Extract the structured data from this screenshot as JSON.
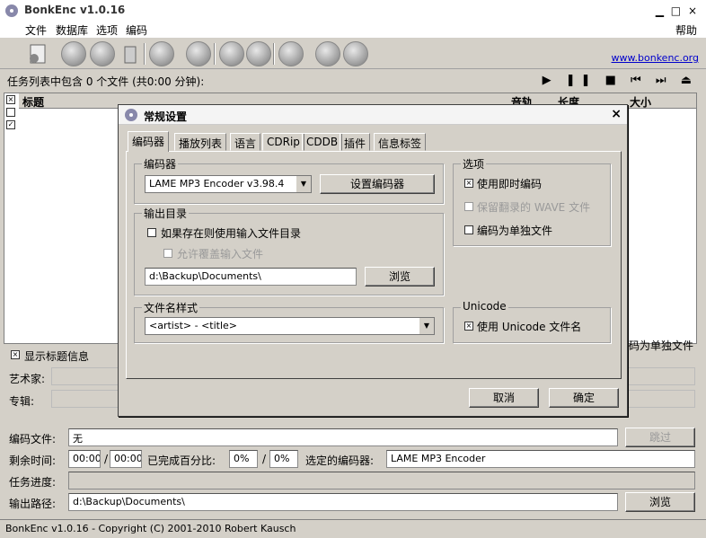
{
  "app": {
    "title": "BonkEnc v1.0.16",
    "controls": "▁ □ ×",
    "website": "www.bonkenc.org"
  },
  "menu": {
    "file": "文件",
    "database": "数据库",
    "options": "选项",
    "encode": "编码",
    "help": "帮助"
  },
  "status": {
    "summary": "任务列表中包含 0 个文件 (共0:00 分钟):"
  },
  "list": {
    "columns": [
      "标题",
      "音轨",
      "长度",
      "大小"
    ]
  },
  "info": {
    "show_title_info": "显示标题信息",
    "artist_label": "艺术家:",
    "album_label": "专辑:",
    "encode_single": "码为单独文件"
  },
  "progress": {
    "encoding_file_label": "编码文件:",
    "encoding_file_value": "无",
    "skip_button": "跳过",
    "remaining_label": "剩余时间:",
    "remaining_value": "00:00",
    "slash": "/",
    "total_value": "00:00",
    "percent_label": "已完成百分比:",
    "percent_value": "0%",
    "percent_total": "0%",
    "selected_encoder_label": "选定的编码器:",
    "selected_encoder_value": "LAME MP3 Encoder",
    "task_progress_label": "任务进度:",
    "output_path_label": "输出路径:",
    "output_path_value": "d:\\Backup\\Documents\\",
    "browse_button": "浏览"
  },
  "footer": {
    "text": "BonkEnc v1.0.16 - Copyright (C) 2001-2010 Robert Kausch"
  },
  "dialog": {
    "title": "常规设置",
    "close": "×",
    "tabs": [
      "编码器",
      "播放列表",
      "语言",
      "CDRip",
      "CDDB",
      "插件",
      "信息标签"
    ],
    "encoder_group": "编码器",
    "encoder_value": "LAME MP3 Encoder v3.98.4",
    "config_encoder_button": "设置编码器",
    "output_group": "输出目录",
    "use_input_dir": "如果存在则使用输入文件目录",
    "allow_overwrite": "允许覆盖输入文件",
    "output_dir_value": "d:\\Backup\\Documents\\",
    "browse_button": "浏览",
    "filename_group": "文件名样式",
    "filename_value": "<artist> - <title>",
    "options_group": "选项",
    "on_the_fly": "使用即时编码",
    "keep_wave": "保留翻录的 WAVE 文件",
    "single_file": "编码为单独文件",
    "unicode_group": "Unicode",
    "use_unicode": "使用 Unicode 文件名",
    "cancel_button": "取消",
    "ok_button": "确定"
  },
  "colors": {
    "link": "#0000cc",
    "window_bg": "#d4d0c8"
  }
}
